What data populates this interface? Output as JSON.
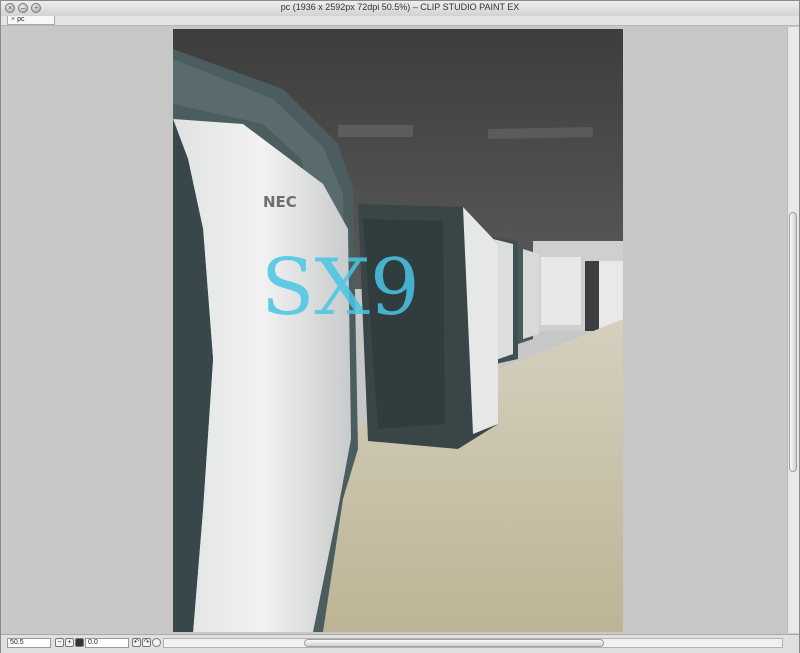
{
  "window": {
    "title": "pc (1936 x 2592px 72dpi 50.5%)  – CLIP STUDIO PAINT EX",
    "controls": [
      "close",
      "minimize",
      "zoom"
    ]
  },
  "tab": {
    "close_glyph": "×",
    "label": "pc"
  },
  "statusbar": {
    "zoom_value": "50.5",
    "angle_value": "0.0"
  },
  "colors": {
    "ceiling": "#4a4a4a",
    "floor": "#c8c0a0",
    "server_panel": "#4e5e60",
    "server_front": "#e4e4e4",
    "logo_accent": "#49c6e5"
  },
  "artwork": {
    "logo_text": "NEC",
    "model_text": "SX9"
  }
}
